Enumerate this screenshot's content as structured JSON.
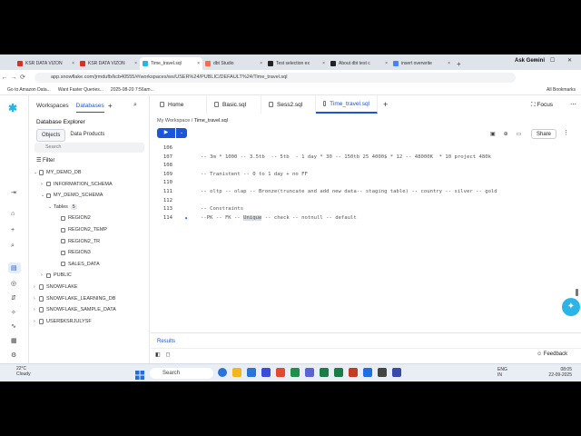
{
  "browser": {
    "tabs": [
      {
        "label": "KSR DATA VIZON",
        "color": "#d93025"
      },
      {
        "label": "KSR DATA VIZON",
        "color": "#d93025"
      },
      {
        "label": "Time_travel.sql",
        "color": "#29b5e8"
      },
      {
        "label": "dbt Studio",
        "color": "#ff694a"
      },
      {
        "label": "Test selection ex",
        "color": "#222222"
      },
      {
        "label": "About dbt test c",
        "color": "#222222"
      },
      {
        "label": "insert overwrite",
        "color": "#4285f4"
      }
    ],
    "active_tab_index": 2,
    "gemini_label": "Ask Gemini",
    "url": "app.snowflake.com/jrmdufb/kcb40555/#/workspaces/ws/USER%24/PUBLIC/DEFAULT%24/Time_travel.sql",
    "bookmarks": [
      "Go to Amazon Data...",
      "Want Faster Queries...",
      "2025-08-20 7:56am..."
    ],
    "all_bookmarks": "All Bookmarks"
  },
  "left_panel": {
    "tabs": [
      "Workspaces",
      "Databases"
    ],
    "active_tab": "Databases",
    "title": "Database Explorer",
    "segments": [
      "Objects",
      "Data Products"
    ],
    "search_placeholder": "Search",
    "filter_label": "Filter",
    "tree": [
      {
        "label": "MY_DEMO_DB",
        "level": 1,
        "expanded": true,
        "type": "db"
      },
      {
        "label": "INFORMATION_SCHEMA",
        "level": 2,
        "expanded": false,
        "type": "schema"
      },
      {
        "label": "MY_DEMO_SCHEMA",
        "level": 2,
        "expanded": true,
        "type": "schema"
      },
      {
        "label": "Tables",
        "level": 3,
        "expanded": true,
        "type": "folder",
        "badge": "5"
      },
      {
        "label": "REGION2",
        "level": 4,
        "type": "table"
      },
      {
        "label": "REGION2_TEMP",
        "level": 4,
        "type": "table"
      },
      {
        "label": "REGION2_TR",
        "level": 4,
        "type": "table"
      },
      {
        "label": "REGION3",
        "level": 4,
        "type": "table"
      },
      {
        "label": "SALES_DATA",
        "level": 4,
        "type": "table"
      },
      {
        "label": "PUBLIC",
        "level": 2,
        "expanded": false,
        "type": "schema"
      },
      {
        "label": "SNOWFLAKE",
        "level": 1,
        "expanded": false,
        "type": "db"
      },
      {
        "label": "SNOWFLAKE_LEARNING_DB",
        "level": 1,
        "expanded": false,
        "type": "db"
      },
      {
        "label": "SNOWFLAKE_SAMPLE_DATA",
        "level": 1,
        "expanded": false,
        "type": "db"
      },
      {
        "label": "USER$KSRJULYSF",
        "level": 1,
        "expanded": false,
        "type": "db"
      }
    ]
  },
  "editor": {
    "tabs": [
      {
        "label": "Home"
      },
      {
        "label": "Basic.sql"
      },
      {
        "label": "Sess2.sql"
      },
      {
        "label": "Time_travel.sql"
      }
    ],
    "active_tab": "Time_travel.sql",
    "breadcrumb": [
      "My Workspace",
      "Time_travel.sql"
    ],
    "focus_label": "Focus",
    "share_label": "Share",
    "lines": [
      {
        "num": "106",
        "text": ""
      },
      {
        "num": "107",
        "text": "-- 3m * 1000 -- 3.5tb  -- 5tb  - 1 day * 30 -- 150tb 25 4000$ * 12 -- 48000K  * 10 project 480k"
      },
      {
        "num": "108",
        "text": ""
      },
      {
        "num": "109",
        "text": "-- Tranistent -- 0 to 1 day + no FF"
      },
      {
        "num": "110",
        "text": ""
      },
      {
        "num": "111",
        "text": "-- oltp -- olap -- Bronze(truncate and add new data-- staging table) -- country -- silver -- gold"
      },
      {
        "num": "112",
        "text": ""
      },
      {
        "num": "113",
        "text": "-- Constraints"
      },
      {
        "num": "114",
        "text_before": "--PK -- FK -- ",
        "text_sel": "Unique",
        "text_after": " -- check -- notnull -- default"
      }
    ],
    "results_label": "Results",
    "feedback_label": "Feedback"
  },
  "taskbar": {
    "weather_temp": "22°C",
    "weather_desc": "Cloudy",
    "search_label": "Search",
    "lang": "ENG",
    "region": "IN",
    "time": "08:05",
    "date": "22-09-2025",
    "app_colors": [
      "#2a73d9",
      "#f2b71c",
      "#2a73d9",
      "#3b4bd9",
      "#e24a2f",
      "#1f8f4a",
      "#5b62d6",
      "#1a7d45",
      "#1a7d45",
      "#c23b22",
      "#1f6fe0",
      "#444444",
      "#3949ab"
    ]
  }
}
